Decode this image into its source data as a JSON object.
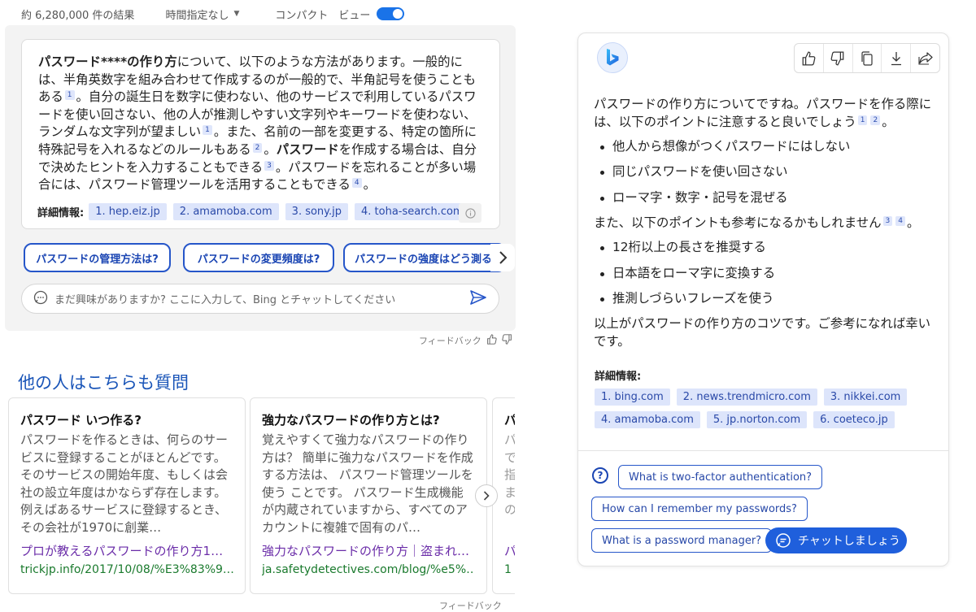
{
  "topbar": {
    "results_count": "約 6,280,000 件の結果",
    "time_filter": "時間指定なし",
    "compact_view_label": "コンパクト　ビュー",
    "compact_view_on": true
  },
  "answer": {
    "parts": [
      {
        "t": "パスワード****の作り方",
        "b": true
      },
      {
        "t": "について、以下のような方法があります。一般的には、半角英数字を組み合わせて作成するのが一般的で、半角記号を使うこともある"
      },
      {
        "c": "1"
      },
      {
        "t": "。自分の誕生日を数字に使わない、他のサービスで利用しているパスワードを使い回さない、他の人が推測しやすい文字列やキーワードを使わない、ランダムな文字列が望ましい"
      },
      {
        "c": "1"
      },
      {
        "t": "。また、名前の一部を変更する、特定の箇所に特殊記号を入れるなどのルールもある"
      },
      {
        "c": "2"
      },
      {
        "t": "。"
      },
      {
        "t": "パスワード",
        "b": true
      },
      {
        "t": "を作成する場合は、自分で決めたヒントを入力することもできる"
      },
      {
        "c": "3"
      },
      {
        "t": "。パスワードを忘れることが多い場合には、パスワード管理ツールを活用することもできる"
      },
      {
        "c": "4"
      },
      {
        "t": "。"
      }
    ],
    "refs_label": "詳細情報:",
    "refs": [
      "1. hep.eiz.jp",
      "2. amamoba.com",
      "3. sony.jp",
      "4. toha-search.com"
    ]
  },
  "suggestions": [
    "パスワードの管理方法は?",
    "パスワードの変更頻度は?",
    "パスワードの強度はどう測る?"
  ],
  "chat_input": {
    "placeholder": "まだ興味がありますか? ここに入力して、Bing とチャットしてください"
  },
  "feedback_label": "フィードバック",
  "paa": {
    "title": "他の人はこちらも質問",
    "cards": [
      {
        "question": "パスワード いつ作る?",
        "body": "パスワードを作るときは、何らのサービスに登録することがほとんどです。 そのサービスの開始年度、もしくは会社の設立年度はかならず存在します。 例えばあるサービスに登録するとき、その会社が1970に創業…",
        "link": "プロが教えるパスワードの作り方1…",
        "url": "trickjp.info/2017/10/08/%E3%83%9…"
      },
      {
        "question": "強力なパスワードの作り方とは?",
        "body": "覚えやすくて強力なパスワードの作り方は？ 簡単に強力なパスワードを作成する方法は、 パスワード管理ツールを使う ことです。 パスワード生成機能が内蔵されていますから、すべてのアカウントに複雑で固有のパ…",
        "link": "強力なパスワードの作り方｜盗まれ…",
        "url": "ja.safetydetectives.com/blog/%e5%…"
      },
      {
        "question": "パ",
        "body": "パ\nで\n指\nま\nの",
        "link": "パ",
        "url": "1"
      }
    ]
  },
  "chat": {
    "intro": "パスワードの作り方についてですね。パスワードを作る際には、以下のポイントに注意すると良いでしょう",
    "intro_cites": [
      "1",
      "2"
    ],
    "intro_end": "。",
    "list1": [
      "他人から想像がつくパスワードにはしない",
      "同じパスワードを使い回さない",
      "ローマ字・数字・記号を混ぜる"
    ],
    "mid": "また、以下のポイントも参考になるかもしれません",
    "mid_cites": [
      "3",
      "4"
    ],
    "mid_end": "。",
    "list2": [
      "12桁以上の長さを推奨する",
      "日本語をローマ字に変換する",
      "推測しづらいフレーズを使う"
    ],
    "closing": "以上がパスワードの作り方のコツです。ご参考になれば幸いです。",
    "refs_label": "詳細情報:",
    "refs": [
      "1. bing.com",
      "2. news.trendmicro.com",
      "3. nikkei.com",
      "4. amamoba.com",
      "5. jp.norton.com",
      "6. coeteco.jp"
    ],
    "followups": [
      "What is two-factor authentication?",
      "How can I remember my passwords?",
      "What is a password manager?"
    ],
    "chat_button": "チャットしましょう"
  },
  "colors": {
    "accent": "#1f5fdc",
    "chip_bg": "#dde5fb",
    "link_purple": "#6a2ca8",
    "url_green": "#1a7a2d"
  }
}
